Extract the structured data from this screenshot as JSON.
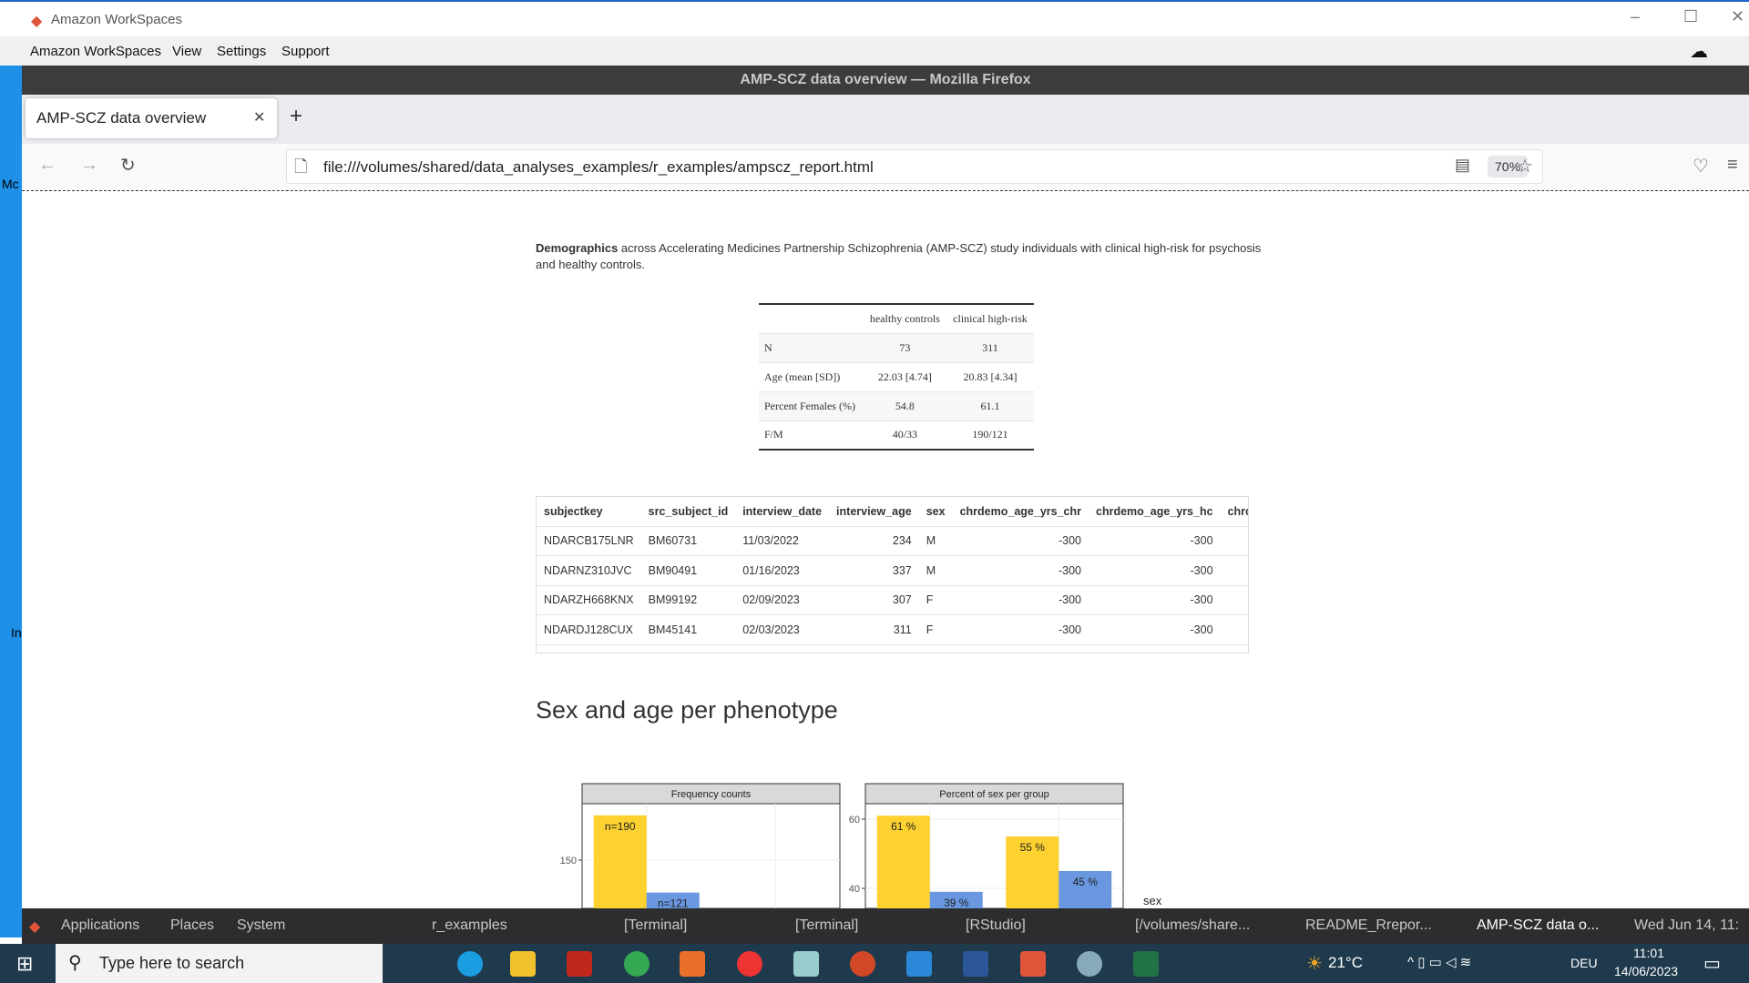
{
  "workspaces": {
    "title": "Amazon WorkSpaces",
    "menu": [
      "Amazon WorkSpaces",
      "View",
      "Settings",
      "Support"
    ]
  },
  "left_strip": {
    "labels": [
      "Mc",
      "In"
    ]
  },
  "firefox": {
    "window_title": "AMP-SCZ data overview — Mozilla Firefox",
    "tab_title": "AMP-SCZ data overview",
    "url": "file:///volumes/shared/data_analyses_examples/r_examples/ampscz_report.html",
    "zoom": "70%"
  },
  "page": {
    "demographics_bold": "Demographics",
    "demographics_text": " across Accelerating Medicines Partnership Schizophrenia (AMP-SCZ) study individuals with clinical high-risk for psychosis and healthy controls.",
    "summary_table": {
      "headers": [
        "",
        "healthy controls",
        "clinical high-risk"
      ],
      "rows": [
        [
          "N",
          "73",
          "311"
        ],
        [
          "Age (mean [SD])",
          "22.03 [4.74]",
          "20.83 [4.34]"
        ],
        [
          "Percent Females (%)",
          "54.8",
          "61.1"
        ],
        [
          "F/M",
          "40/33",
          "190/121"
        ]
      ]
    },
    "data_table": {
      "headers": [
        "subjectkey",
        "src_subject_id",
        "interview_date",
        "interview_age",
        "sex",
        "chrdemo_age_yrs_chr",
        "chrdemo_age_yrs_hc",
        "chrc"
      ],
      "rows": [
        [
          "NDARCB175LNR",
          "BM60731",
          "11/03/2022",
          "234",
          "M",
          "-300",
          "-300",
          ""
        ],
        [
          "NDARNZ310JVC",
          "BM90491",
          "01/16/2023",
          "337",
          "M",
          "-300",
          "-300",
          ""
        ],
        [
          "NDARZH668KNX",
          "BM99192",
          "02/09/2023",
          "307",
          "F",
          "-300",
          "-300",
          ""
        ],
        [
          "NDARDJ128CUX",
          "BM45141",
          "02/03/2023",
          "311",
          "F",
          "-300",
          "-300",
          ""
        ]
      ]
    },
    "section_heading": "Sex and age per phenotype",
    "legend_title": "sex"
  },
  "chart_data": [
    {
      "type": "bar",
      "title": "Frequency counts",
      "yticks": [
        150
      ],
      "series_colors": {
        "F": "#fdd12f",
        "M": "#6a98e0"
      },
      "bars": [
        {
          "group": 1,
          "sex": "F",
          "value": 190,
          "label": "n=190"
        },
        {
          "group": 1,
          "sex": "M",
          "value": 121,
          "label": "n=121"
        }
      ]
    },
    {
      "type": "bar",
      "title": "Percent of sex per group",
      "yticks": [
        40,
        60
      ],
      "series_colors": {
        "F": "#fdd12f",
        "M": "#6a98e0"
      },
      "bars": [
        {
          "group": 1,
          "sex": "F",
          "value": 61,
          "label": "61 %"
        },
        {
          "group": 1,
          "sex": "M",
          "value": 39,
          "label": "39 %"
        },
        {
          "group": 2,
          "sex": "F",
          "value": 55,
          "label": "55 %"
        },
        {
          "group": 2,
          "sex": "M",
          "value": 45,
          "label": "45 %"
        }
      ]
    }
  ],
  "gnome_panel": {
    "items": [
      "Applications",
      "Places",
      "System",
      "r_examples",
      "[Terminal]",
      "[Terminal]",
      "[RStudio]",
      "[/volumes/share...",
      "README_Rrepor...",
      "AMP-SCZ data o..."
    ],
    "clock": "Wed Jun 14, 11:"
  },
  "taskbar": {
    "search_placeholder": "Type here to search",
    "weather": "21°C",
    "language": "DEU",
    "time": "11:01",
    "date": "14/06/2023"
  }
}
